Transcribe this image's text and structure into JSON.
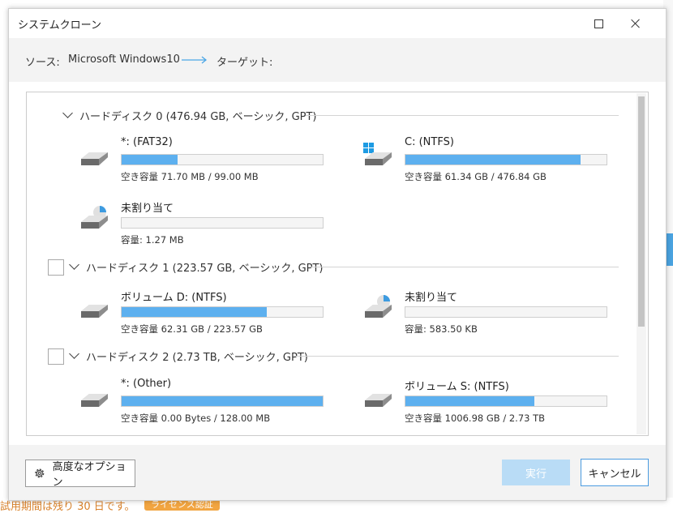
{
  "window": {
    "title": "システムクローン"
  },
  "header": {
    "source_label": "ソース:",
    "source_value": "Microsoft Windows10",
    "target_label": "ターゲット:"
  },
  "disks": [
    {
      "label": "ハードディスク 0 (476.94 GB, ベーシック, GPT)",
      "partitions": [
        {
          "name": "*: (FAT32)",
          "info": "空き容量 71.70 MB / 99.00 MB",
          "fill": 0.28,
          "icon": "drive-icon"
        },
        {
          "name": "C: (NTFS)",
          "info": "空き容量 61.34 GB / 476.84 GB",
          "fill": 0.87,
          "icon": "windows-drive-icon"
        },
        {
          "name": "未割り当て",
          "info": "容量: 1.27 MB",
          "fill": 0,
          "icon": "unallocated-drive-icon"
        }
      ]
    },
    {
      "label": "ハードディスク 1 (223.57 GB, ベーシック, GPT)",
      "partitions": [
        {
          "name": "ボリューム D: (NTFS)",
          "info": "空き容量 62.31 GB / 223.57 GB",
          "fill": 0.72,
          "icon": "drive-icon"
        },
        {
          "name": "未割り当て",
          "info": "容量: 583.50 KB",
          "fill": 0,
          "icon": "unallocated-drive-icon"
        }
      ]
    },
    {
      "label": "ハードディスク 2 (2.73 TB, ベーシック, GPT)",
      "partitions": [
        {
          "name": "*: (Other)",
          "info": "空き容量 0.00 Bytes / 128.00 MB",
          "fill": 1.0,
          "icon": "drive-icon"
        },
        {
          "name": "ボリューム S: (NTFS)",
          "info": "空き容量 1006.98 GB / 2.73 TB",
          "fill": 0.64,
          "icon": "drive-icon"
        }
      ]
    }
  ],
  "footer": {
    "advanced_label": "高度なオプション",
    "execute_label": "実行",
    "cancel_label": "キャンセル"
  },
  "background": {
    "trial_text": "試用期間は残り 30 日です。",
    "license_text": "ライセンス認証"
  },
  "colors": {
    "accent": "#5db0ef",
    "execute_disabled": "#b9dcf6",
    "cancel_border": "#4b9be0"
  }
}
